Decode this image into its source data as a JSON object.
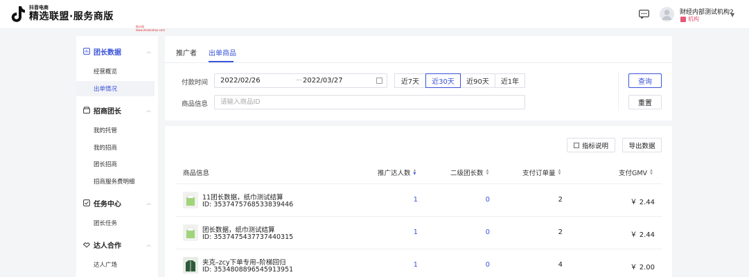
{
  "header": {
    "brand_small": "抖音电商",
    "brand_title": "精选联盟·服务商版",
    "user_name": "财经内部测试机构2",
    "user_role": "机构",
    "watermark_line1": "指卡网",
    "watermark_line2": "www.zhaokahao.com"
  },
  "sidebar": {
    "groups": [
      {
        "label": "团长数据",
        "items": [
          "经营概览",
          "出单情况"
        ]
      },
      {
        "label": "招商团长",
        "items": [
          "我的托管",
          "我的招商",
          "团长招商",
          "招商服务费明细"
        ]
      },
      {
        "label": "任务中心",
        "items": [
          "团长任务"
        ]
      },
      {
        "label": "达人合作",
        "items": [
          "达人广场"
        ]
      }
    ],
    "active_item": "出单情况"
  },
  "tabs": [
    {
      "label": "推广者"
    },
    {
      "label": "出单商品"
    }
  ],
  "filters": {
    "date_label": "付款时间",
    "start_date": "2022/02/26",
    "end_date": "2022/03/27",
    "date_separator": "—",
    "ranges": [
      "近7天",
      "近30天",
      "近90天",
      "近1年"
    ],
    "active_range": "近30天",
    "product_label": "商品信息",
    "product_placeholder": "请输入商品ID",
    "query_label": "查询",
    "reset_label": "重置"
  },
  "table": {
    "metric_button": "指标说明",
    "export_button": "导出数据",
    "columns": [
      "商品信息",
      "推广达人数",
      "二级团长数",
      "支付订单量",
      "支付GMV"
    ],
    "rows": [
      {
        "name": "11团长数据，纸巾测试结算",
        "id": "ID: 3537475768533839446",
        "promoters": "1",
        "sub_leaders": "0",
        "orders": "2",
        "gmv": "￥ 2.44"
      },
      {
        "name": "团长数据，纸巾测试结算",
        "id": "ID: 3537475437737440315",
        "promoters": "1",
        "sub_leaders": "0",
        "orders": "2",
        "gmv": "￥ 2.44"
      },
      {
        "name": "夹克–zcy下单专用–阶梯回归",
        "id": "ID: 3534808896545913951",
        "promoters": "1",
        "sub_leaders": "0",
        "orders": "4",
        "gmv": "￥ 2.00"
      }
    ]
  },
  "colors": {
    "accent": "#3a53d8",
    "role": "#e8587a",
    "background": "#f4f5f7"
  }
}
